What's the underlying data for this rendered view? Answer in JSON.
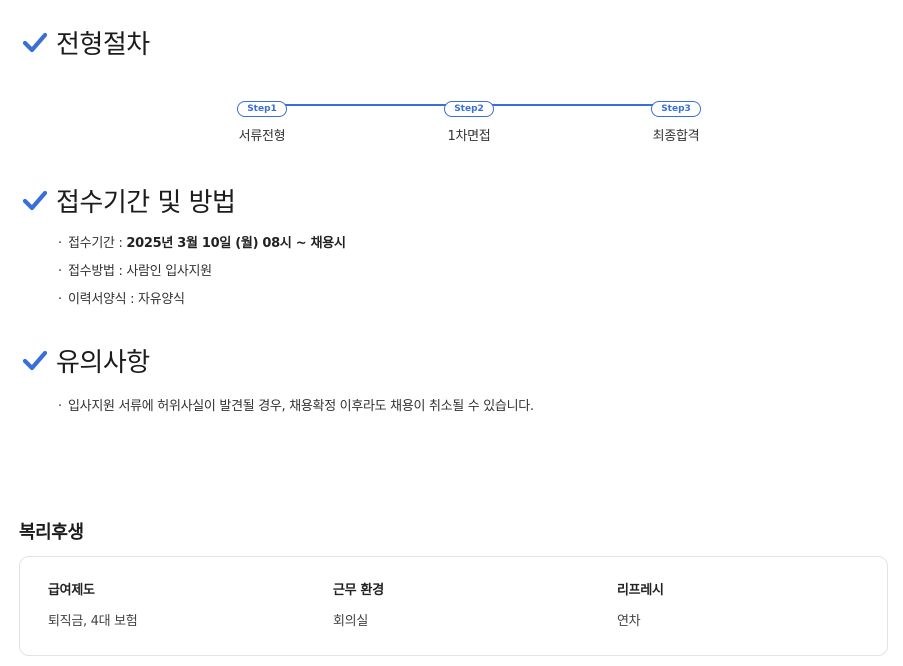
{
  "sections": {
    "process": {
      "title": "전형절차",
      "steps": [
        {
          "pill": "Step1",
          "label": "서류전형"
        },
        {
          "pill": "Step2",
          "label": "1차면접"
        },
        {
          "pill": "Step3",
          "label": "최종합격"
        }
      ]
    },
    "apply": {
      "title": "접수기간 및 방법",
      "items": [
        {
          "label": "접수기간 : ",
          "value": "2025년 3월 10일 (월) 08시 ~ 채용시"
        },
        {
          "label": "접수방법 : ",
          "value": "사람인 입사지원"
        },
        {
          "label": "이력서양식 : ",
          "value": "자유양식"
        }
      ]
    },
    "notes": {
      "title": "유의사항",
      "items": [
        {
          "text": "입사지원 서류에 허위사실이 발견될 경우, 채용확정 이후라도 채용이 취소될 수 있습니다."
        }
      ]
    }
  },
  "benefits": {
    "title": "복리후생",
    "columns": [
      {
        "head": "급여제도",
        "value": "퇴직금, 4대 보험"
      },
      {
        "head": "근무 환경",
        "value": "회의실"
      },
      {
        "head": "리프레시",
        "value": "연차"
      }
    ]
  },
  "colors": {
    "accent": "#3a6fd8"
  },
  "icons": {
    "heading_icon": "check-icon",
    "bullet": "·"
  }
}
